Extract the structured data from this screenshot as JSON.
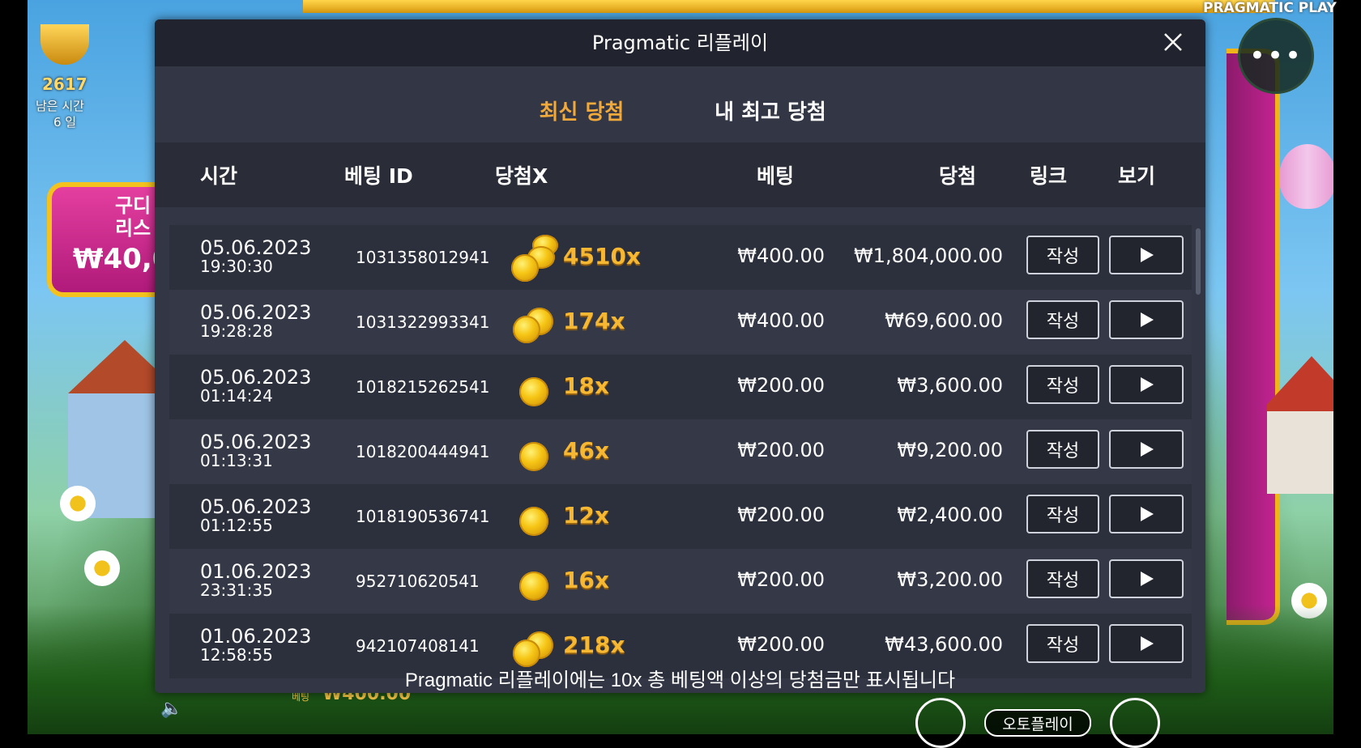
{
  "game": {
    "brand": "PRAGMATIC PLAY",
    "tournament_count": "2617",
    "remaining_label": "남은 시간",
    "remaining_value": "6 일",
    "promo_text_line1": "구디",
    "promo_text_line2": "리스",
    "promo_amount": "₩40,0",
    "bet_label": "베팅",
    "bet_value": "₩400.00",
    "autoplay_label": "오토플레이"
  },
  "modal": {
    "title": "Pragmatic 리플레이",
    "tabs": [
      {
        "label": "최신 당첨",
        "active": true
      },
      {
        "label": "내 최고 당첨",
        "active": false
      }
    ],
    "columns": {
      "time": "시간",
      "bet_id": "베팅 ID",
      "win_multiplier": "당첨X",
      "bet": "베팅",
      "win": "당첨",
      "link": "링크",
      "view": "보기"
    },
    "rows": [
      {
        "date": "05.06.2023",
        "time": "19:30:30",
        "bet_id": "1031358012941",
        "multiplier": "4510x",
        "coins": 3,
        "bet": "₩400.00",
        "win": "₩1,804,000.00",
        "link_label": "작성"
      },
      {
        "date": "05.06.2023",
        "time": "19:28:28",
        "bet_id": "1031322993341",
        "multiplier": "174x",
        "coins": 2,
        "bet": "₩400.00",
        "win": "₩69,600.00",
        "link_label": "작성"
      },
      {
        "date": "05.06.2023",
        "time": "01:14:24",
        "bet_id": "1018215262541",
        "multiplier": "18x",
        "coins": 1,
        "bet": "₩200.00",
        "win": "₩3,600.00",
        "link_label": "작성"
      },
      {
        "date": "05.06.2023",
        "time": "01:13:31",
        "bet_id": "1018200444941",
        "multiplier": "46x",
        "coins": 1,
        "bet": "₩200.00",
        "win": "₩9,200.00",
        "link_label": "작성"
      },
      {
        "date": "05.06.2023",
        "time": "01:12:55",
        "bet_id": "1018190536741",
        "multiplier": "12x",
        "coins": 1,
        "bet": "₩200.00",
        "win": "₩2,400.00",
        "link_label": "작성"
      },
      {
        "date": "01.06.2023",
        "time": "23:31:35",
        "bet_id": "952710620541",
        "multiplier": "16x",
        "coins": 1,
        "bet": "₩200.00",
        "win": "₩3,200.00",
        "link_label": "작성"
      },
      {
        "date": "01.06.2023",
        "time": "12:58:55",
        "bet_id": "942107408141",
        "multiplier": "218x",
        "coins": 2,
        "bet": "₩200.00",
        "win": "₩43,600.00",
        "link_label": "작성"
      }
    ],
    "footer_note": "Pragmatic 리플레이에는 10x 총 베팅액 이상의 당첨금만 표시됩니다"
  },
  "colors": {
    "accent": "#f0a93a",
    "panel": "#323645",
    "header": "#21232e",
    "multiplier": "#f6b733"
  },
  "icons": {
    "close": "close-icon",
    "play": "play-icon",
    "menu": "more-dots-icon",
    "trophy": "trophy-icon",
    "coin": "coin-icon",
    "speaker": "speaker-icon"
  }
}
